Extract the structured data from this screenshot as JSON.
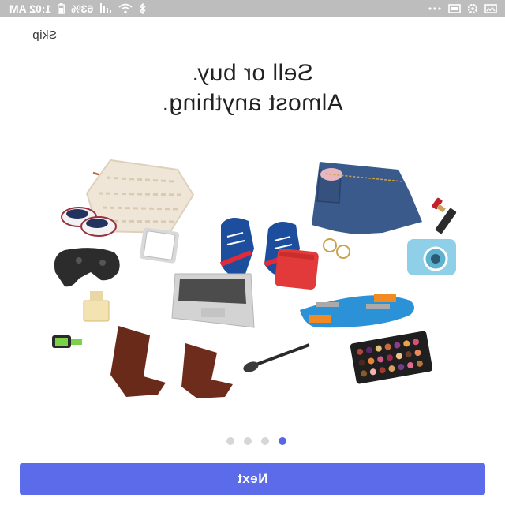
{
  "status_bar": {
    "time": "1:02 AM",
    "battery": "63%"
  },
  "skip_label": "Skip",
  "headline": {
    "line1": "Sell or buy.",
    "line2": "Almost anything."
  },
  "illustration": {
    "items": [
      "glasses-icon",
      "sweater-icon",
      "jeans-icon",
      "lipstick-icon",
      "baby-shoes-icon",
      "phone-icon",
      "sneakers-icon",
      "earrings-icon",
      "camera-icon",
      "gamepad-icon",
      "wallet-icon",
      "perfume-icon",
      "laptop-icon",
      "skateboard-icon",
      "smartwatch-icon",
      "boots-icon",
      "makeup-brush-icon",
      "eyeshadow-palette-icon"
    ]
  },
  "pager": {
    "count": 4,
    "active_index": 3
  },
  "next_label": "Next",
  "colors": {
    "accent": "#5c6bea",
    "status_bar": "#bdbdbd"
  }
}
